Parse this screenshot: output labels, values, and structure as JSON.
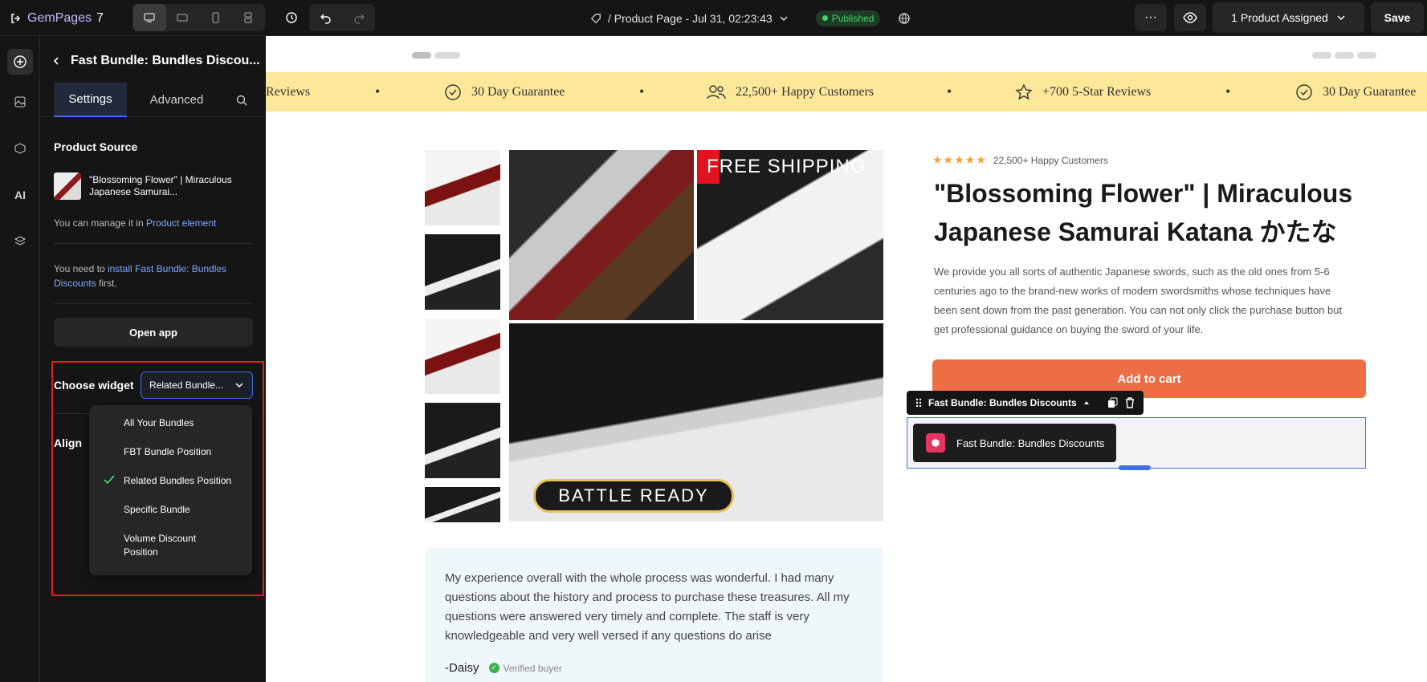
{
  "topbar": {
    "logo": "GemPages",
    "version": "7",
    "page_name": "/ Product Page - Jul 31, 02:23:43",
    "status": "Published",
    "assign_label": "1 Product Assigned",
    "save_label": "Save",
    "more_label": "···"
  },
  "panel": {
    "title": "Fast Bundle: Bundles Discou...",
    "tabs": [
      "Settings",
      "Advanced"
    ],
    "product_source_title": "Product Source",
    "product_name": "\"Blossoming Flower\" | Miraculous Japanese Samurai...",
    "manage_text": "You can manage it in",
    "manage_link": "Product element",
    "install_prefix": "You need to",
    "install_link": "install Fast Bundle: Bundles Discounts",
    "install_suffix": "first.",
    "open_app": "Open app",
    "choose_widget_label": "Choose widget",
    "choose_widget_value": "Related Bundle...",
    "align_label": "Align",
    "menu_items": [
      "All Your Bundles",
      "FBT Bundle Position",
      "Related Bundles Position",
      "Specific Bundle",
      "Volume Discount Position"
    ],
    "menu_selected": "Related Bundles Position"
  },
  "marquee": {
    "items": [
      "Reviews",
      "30 Day Guarantee",
      "22,500+ Happy Customers",
      "+700 5-Star Reviews",
      "30 Day Guarantee"
    ]
  },
  "product": {
    "free_shipping": "FREE SHIPPING",
    "battle_ready": "BATTLE READY",
    "rating_text": "22,500+ Happy Customers",
    "title": "\"Blossoming Flower\" | Miraculous Japanese Samurai Katana かたな",
    "description": "We provide you all sorts of authentic Japanese swords, such as the old ones from 5-6 centuries ago to the brand-new works of modern swordsmiths whose techniques have been sent down from the past generation. You can not only click the purchase button but get professional guidance on buying the sword of your life.",
    "add_to_cart": "Add to cart"
  },
  "review": {
    "text": "My experience overall with the whole process was wonderful. I had many questions about the history and process to purchase these treasures. All my questions were answered very timely and complete. The staff is very knowledgeable and very well versed if any questions do arise",
    "author": "-Daisy",
    "verified": "Verified buyer"
  },
  "widget": {
    "toolbar_label": "Fast Bundle: Bundles Discounts",
    "name": "Fast Bundle: Bundles Discounts"
  },
  "colors": {
    "accent": "#3f6ee6",
    "cart": "#ed6d45",
    "marquee_bg": "#fde89a",
    "highlight": "#e02020",
    "published": "#3fd56b"
  }
}
